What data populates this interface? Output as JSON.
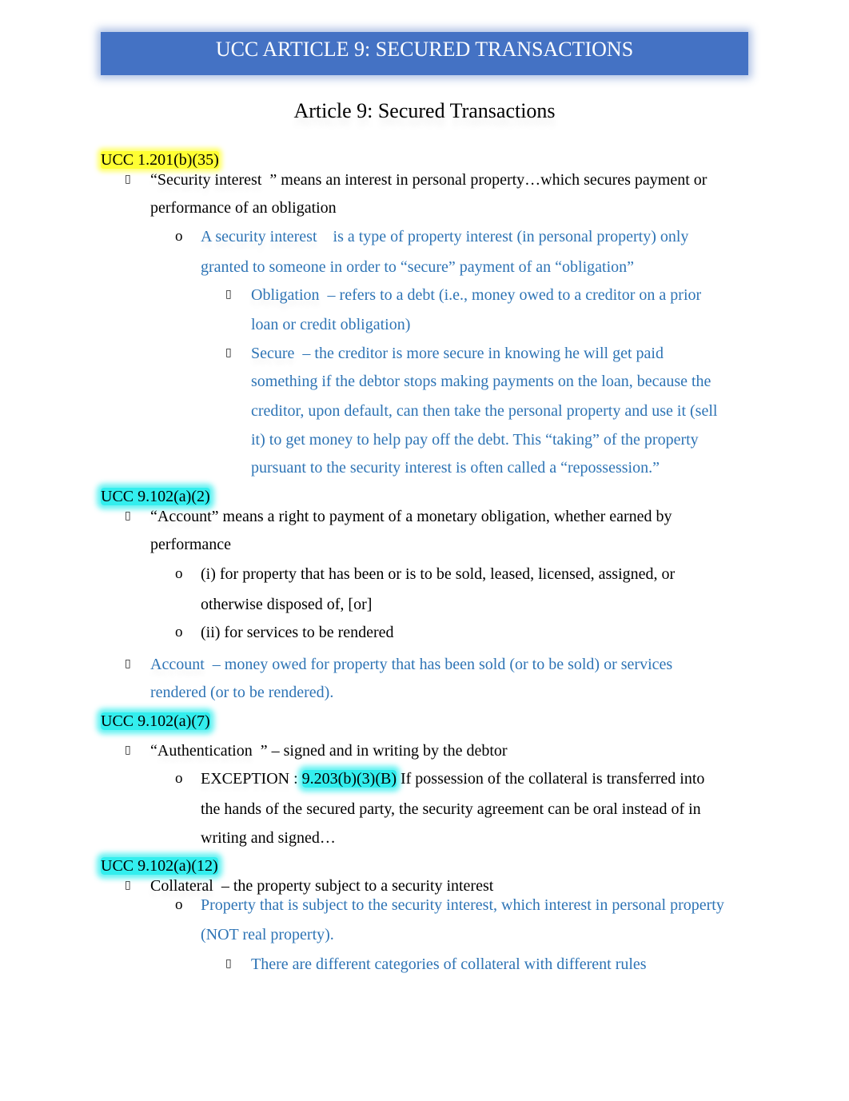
{
  "banner": {
    "title": "UCC ARTICLE 9: SECURED TRANSACTIONS",
    "color": "#4472c4"
  },
  "subtitle": "Article 9: Secured Transactions",
  "colors": {
    "blue_text": "#2e74b5",
    "yellow_highlight": "#ffff33",
    "cyan_highlight": "#33eeee"
  },
  "icons": {
    "square_bullet": "square-bullet-icon",
    "circle_bullet": "o-bullet-icon"
  },
  "sections": [
    {
      "heading": "UCC 1.201(b)(35)",
      "l1_1a": "“Security interest",
      "l1_1b": "” means an interest in personal property…which secures payment or",
      "l1_2": "performance of an obligation",
      "l2_1a": "A security interest",
      "l2_1b": "is a type of property interest (in personal property) only",
      "l2_2": "granted to someone in order to “secure” payment of an “obligation”",
      "l3a_term": "Obligation",
      "l3a_1": "– refers to a debt (i.e., money owed to a creditor on a prior",
      "l3a_2": "loan or credit obligation)",
      "l3b_term": "Secure",
      "l3b_1": "– the creditor is more secure in knowing he will get paid",
      "l3b_2": "something if the debtor stops making payments on the loan, because the",
      "l3b_3": "creditor, upon default, can then take the personal property and use it (sell",
      "l3b_4": "it) to get money to help pay off the debt. This “taking” of the property",
      "l3b_5": "pursuant to the security interest is often called a “repossession.”"
    },
    {
      "heading": "UCC 9.102(a)(2)",
      "l1_1a": "“Account",
      "l1_1b": "” means a right to payment of a monetary obligation, whether earned by",
      "l1_2": "performance",
      "l2a_1": "(i) for property that has been or is to be sold, leased, licensed, assigned, or",
      "l2a_2": "otherwise disposed of, [or]",
      "l2b_1": "(ii) for services to be rendered",
      "note_term": "Account",
      "note_1": "– money owed for property that has been sold (or to be sold) or services",
      "note_2": "rendered (or to be rendered)."
    },
    {
      "heading": "UCC 9.102(a)(7)",
      "l1_1a": "“Authentication",
      "l1_1b": "” – signed and in writing by the debtor",
      "l2_term": "EXCEPTION",
      "l2_colon": ":",
      "l2_ref": "9.203(b)(3)(B)",
      "l2_1": "If possession of the collateral is transferred into",
      "l2_2": "the hands of the secured party, the security agreement can be oral instead of in",
      "l2_3": "writing and signed…"
    },
    {
      "heading": "UCC 9.102(a)(12)",
      "l1_term": "Collateral",
      "l1_1": "– the property subject to a security interest",
      "l2_1": "Property that is subject to the security interest, which interest in personal property",
      "l2_2": "(NOT real property).",
      "l3_1": "There are different categories of collateral with different rules"
    }
  ]
}
